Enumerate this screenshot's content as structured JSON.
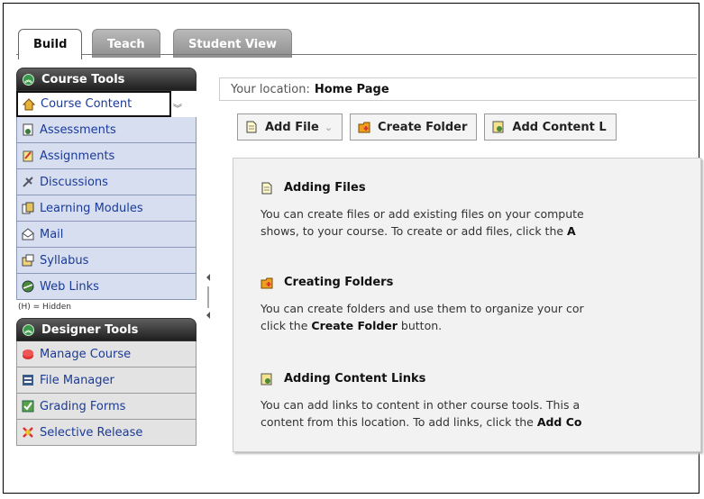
{
  "tabs": [
    {
      "label": "Build",
      "active": true
    },
    {
      "label": "Teach",
      "active": false
    },
    {
      "label": "Student View",
      "active": false
    }
  ],
  "course_tools": {
    "title": "Course Tools",
    "items": [
      {
        "label": "Course Content",
        "icon": "home-icon",
        "selected": true
      },
      {
        "label": "Assessments",
        "icon": "assessment-icon"
      },
      {
        "label": "Assignments",
        "icon": "assignment-icon"
      },
      {
        "label": "Discussions",
        "icon": "discussion-icon"
      },
      {
        "label": "Learning Modules",
        "icon": "module-icon"
      },
      {
        "label": "Mail",
        "icon": "mail-icon"
      },
      {
        "label": "Syllabus",
        "icon": "syllabus-icon"
      },
      {
        "label": "Web Links",
        "icon": "web-link-icon"
      }
    ],
    "hidden_note": "(H) = Hidden"
  },
  "designer_tools": {
    "title": "Designer Tools",
    "items": [
      {
        "label": "Manage Course",
        "icon": "manage-course-icon"
      },
      {
        "label": "File Manager",
        "icon": "file-manager-icon"
      },
      {
        "label": "Grading Forms",
        "icon": "grading-forms-icon"
      },
      {
        "label": "Selective Release",
        "icon": "selective-release-icon"
      }
    ]
  },
  "location": {
    "prefix": "Your location:",
    "page": "Home Page"
  },
  "toolbar": {
    "add_file": "Add File",
    "create_folder": "Create Folder",
    "add_content_link": "Add Content L"
  },
  "info": {
    "adding_files": {
      "title": "Adding Files",
      "line1": "You can create files or add existing files on your compute",
      "line2_pre": "shows, to your course. To create or add files, click the ",
      "line2_bold": "A"
    },
    "creating_folders": {
      "title": "Creating Folders",
      "line1": "You can create folders and use them to organize your cor",
      "line2_pre": "click the ",
      "line2_bold": "Create Folder",
      "line2_post": " button."
    },
    "adding_links": {
      "title": "Adding Content Links",
      "line1": "You can add links to content in other course tools. This a",
      "line2_pre": "content from this location. To add links, click the ",
      "line2_bold": "Add Co"
    }
  },
  "colors": {
    "nav_bg": "#d6def0",
    "nav_text": "#1a3a9a",
    "panel_head": "#1e1e1e",
    "green": "#3a9a4a"
  }
}
